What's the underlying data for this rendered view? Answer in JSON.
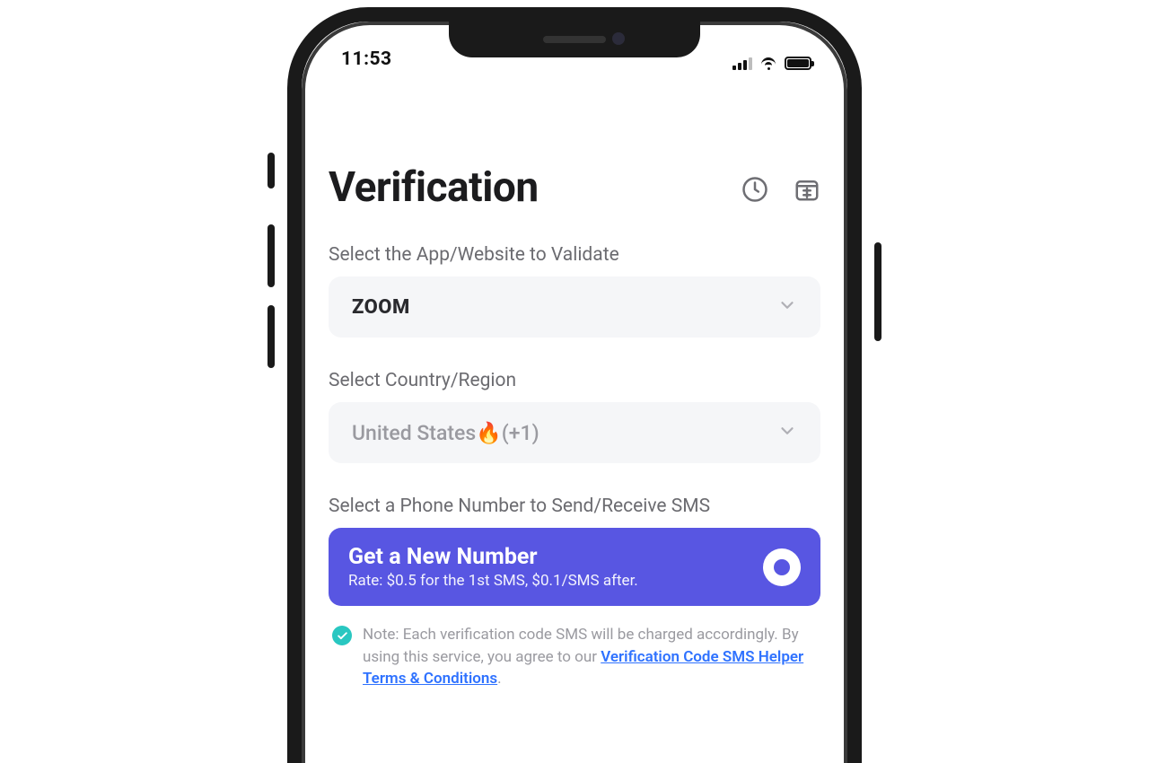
{
  "status": {
    "time": "11:53"
  },
  "header": {
    "title": "Verification"
  },
  "app_select": {
    "label": "Select the App/Website to Validate",
    "value": "ZOOM"
  },
  "country_select": {
    "label": "Select Country/Region",
    "value": "United States🔥(+1)"
  },
  "phone_section": {
    "label": "Select a Phone Number to Send/Receive SMS",
    "cta_title": "Get a New Number",
    "cta_subtitle": "Rate: $0.5 for the 1st SMS, $0.1/SMS after."
  },
  "note": {
    "prefix": "Note: Each verification code SMS will be charged accordingly. By using this service, you agree to our ",
    "link_text": "Verification Code SMS Helper Terms & Conditions",
    "suffix": "."
  },
  "colors": {
    "primary": "#5856e2",
    "link": "#2f72ff",
    "badge": "#29c7c1"
  }
}
